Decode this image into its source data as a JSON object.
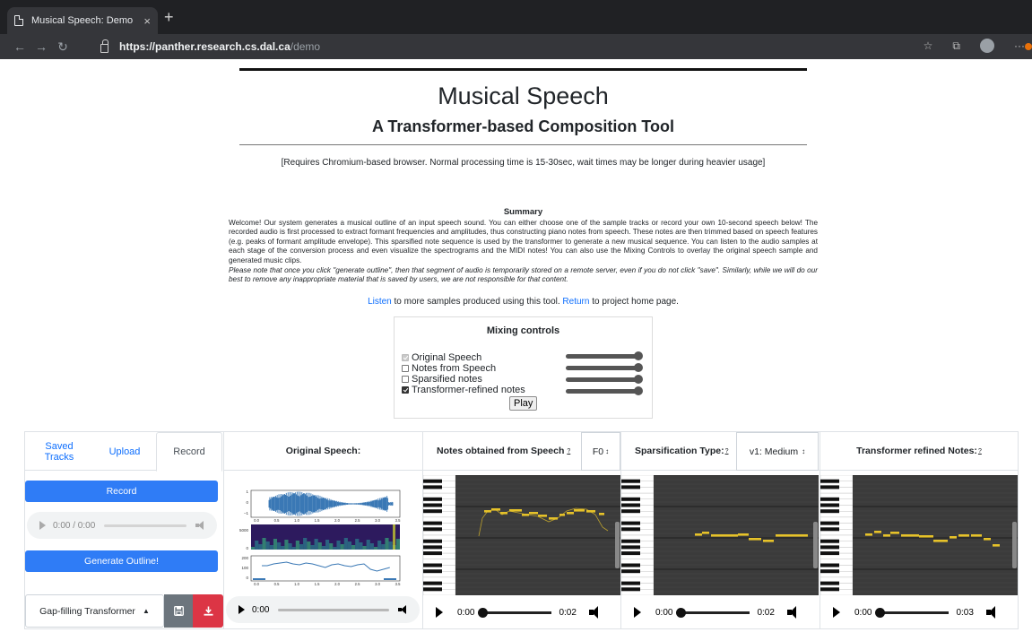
{
  "browser": {
    "tab_title": "Musical Speech: Demo",
    "tab_close": "×",
    "new_tab": "+",
    "url_host": "https://panther.research.cs.dal.ca",
    "url_path": "/demo"
  },
  "header": {
    "title": "Musical Speech",
    "subtitle": "A Transformer-based Composition Tool",
    "notice": "[Requires Chromium-based browser. Normal processing time is 15-30sec, wait times may be longer during heavier usage]"
  },
  "summary": {
    "title": "Summary",
    "body": "Welcome! Our system generates a musical outline of an input speech sound. You can either choose one of the sample tracks or record your own 10-second speech below! The recorded audio is first processed to extract formant frequencies and amplitudes, thus constructing piano notes from speech. These notes are then trimmed based on speech features (e.g. peaks of formant amplitude envelope). This sparsified note sequence is used by the transformer to generate a new musical sequence. You can listen to the audio samples at each stage of the conversion process and even visualize the spectrograms and the MIDI notes! You can also use the Mixing Controls to overlay the original speech sample and generated music clips.",
    "note": "Please note that once you click \"generate outline\", then that segment of audio is temporarily stored on a remote server, even if you do not click \"save\". Similarly, while we will do our best to remove any inappropriate material that is saved by users, we are not responsible for that content."
  },
  "links": {
    "listen": "Listen",
    "listen_rest": " to more samples produced using this tool. ",
    "return": "Return",
    "return_rest": " to project home page."
  },
  "mixing": {
    "title": "Mixing controls",
    "rows": [
      {
        "label": "Original Speech",
        "checked": true,
        "disabled": true
      },
      {
        "label": "Notes from Speech",
        "checked": false,
        "disabled": false
      },
      {
        "label": "Sparsified notes",
        "checked": false,
        "disabled": false
      },
      {
        "label": "Transformer-refined notes",
        "checked": true,
        "disabled": false
      }
    ],
    "play_label": "Play"
  },
  "input_panel": {
    "tabs": [
      "Saved Tracks",
      "Upload",
      "Record"
    ],
    "active_tab": "Record",
    "record_label": "Record",
    "audio_time": "0:00 / 0:00",
    "generate_label": "Generate Outline!",
    "model_select": "Gap-filling Transformer"
  },
  "original_panel": {
    "title": "Original Speech:",
    "audio_time": "0:00"
  },
  "notes_panel": {
    "title": "Notes obtained from Speech",
    "help": "?",
    "select": "F0",
    "time_start": "0:00",
    "time_end": "0:02"
  },
  "sparse_panel": {
    "title": "Sparsification Type:",
    "help": "?",
    "select": "v1: Medium",
    "time_start": "0:00",
    "time_end": "0:02"
  },
  "refined_panel": {
    "title": "Transformer refined Notes:",
    "help": "?",
    "time_start": "0:00",
    "time_end": "0:03"
  },
  "waveform_ticks": {
    "top_y": [
      "1",
      "0",
      "−1"
    ],
    "mid_y": [
      "5000",
      "0"
    ],
    "bot_y": [
      "200",
      "100",
      "0"
    ],
    "x": [
      "0.0",
      "0.5",
      "1.0",
      "1.5",
      "2.0",
      "2.5",
      "3.0",
      "3.5"
    ]
  },
  "colors": {
    "accent_blue": "#2f7cf6",
    "danger_red": "#dc3545",
    "secondary_gray": "#6c757d",
    "note_yellow": "#e6c229",
    "waveform_blue": "#3a78b5",
    "roll_bg": "#3b3b3b"
  }
}
